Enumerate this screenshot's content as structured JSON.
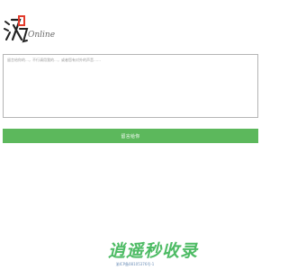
{
  "logo": {
    "text": "Online",
    "colors": {
      "main": "#222222",
      "accent": "#e23a2b"
    }
  },
  "feedback": {
    "placeholder": "留言给你的…，不行请用我的…，或者您有对外的声音……"
  },
  "submit": {
    "label": "留言给你"
  },
  "watermark": {
    "text": "逍遥秒收录"
  },
  "footer": {
    "text": "渝ICP备08105376号-1"
  },
  "colors": {
    "button": "#5cb85c",
    "watermark": "#2fb04a",
    "border": "#b5b5b5"
  }
}
